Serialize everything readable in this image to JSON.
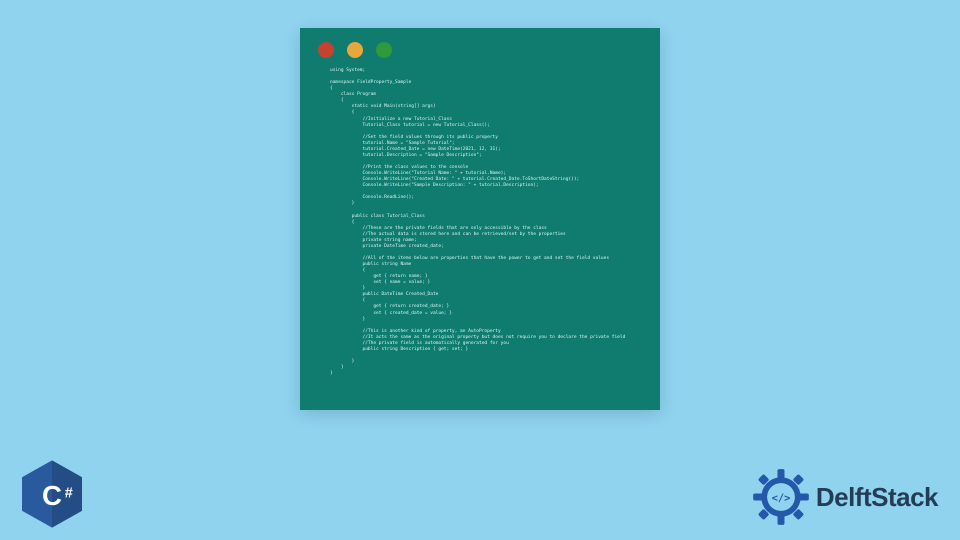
{
  "window": {
    "dots": [
      "red",
      "yellow",
      "green"
    ]
  },
  "code": {
    "lines": [
      "using System;",
      "",
      "namespace FieldProperty_Sample",
      "{",
      "    class Program",
      "    {",
      "        static void Main(string[] args)",
      "        {",
      "            //Initialize a new Tutorial_Class",
      "            Tutorial_Class tutorial = new Tutorial_Class();",
      "",
      "            //Set the field values through its public property",
      "            tutorial.Name = \"Sample Tutorial\";",
      "            tutorial.Created_Date = new DateTime(2021, 12, 31);",
      "            tutorial.Description = \"Sample Description\";",
      "",
      "            //Print the class values to the console",
      "            Console.WriteLine(\"Tutorial Name: \" + tutorial.Name);",
      "            Console.WriteLine(\"Created Date: \" + tutorial.Created_Date.ToShortDateString());",
      "            Console.WriteLine(\"Sample Description: \" + tutorial.Description);",
      "",
      "            Console.ReadLine();",
      "        }",
      "",
      "        public class Tutorial_Class",
      "        {",
      "            //These are the private fields that are only accessible by the class",
      "            //The actual data is stored here and can be retrieved/set by the properties",
      "            private string name;",
      "            private DateTime created_date;",
      "",
      "            //All of the items below are properties that have the power to get and set the field values",
      "            public string Name",
      "            {",
      "                get { return name; }",
      "                set { name = value; }",
      "            }",
      "            public DateTime Created_Date",
      "            {",
      "                get { return created_date; }",
      "                set { created_date = value; }",
      "            }",
      "",
      "            //This is another kind of property, an AutoProperty",
      "            //It acts the same as the original property but does not require you to declare the private field",
      "            //The private field is automatically generated for you",
      "            public string Description { get; set; }",
      "",
      "        }",
      "    }",
      "}"
    ]
  },
  "badge": {
    "language": "C#"
  },
  "brand": {
    "name": "DelftStack"
  }
}
